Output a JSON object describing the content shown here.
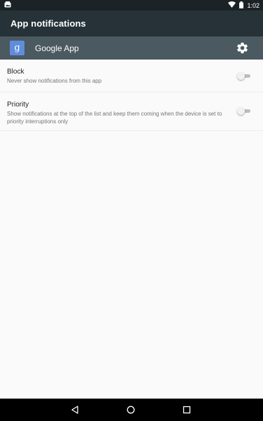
{
  "status_bar": {
    "time": "1:02",
    "icons": [
      "photo-notification-icon",
      "wifi-icon",
      "battery-icon"
    ]
  },
  "app_bar": {
    "title": "App notifications"
  },
  "app_header": {
    "icon_glyph": "g",
    "app_name": "Google App",
    "icon_color": "#5f8ddc"
  },
  "settings": [
    {
      "title": "Block",
      "summary": "Never show notifications from this app",
      "enabled": false
    },
    {
      "title": "Priority",
      "summary": "Show notifications at the top of the list and keep them coming when the device is set to priority interruptions only",
      "enabled": false
    }
  ],
  "nav_bar": {
    "buttons": [
      "back-icon",
      "home-icon",
      "recents-icon"
    ]
  },
  "colors": {
    "status_bar": "#1c2327",
    "app_bar": "#263238",
    "app_header": "#4b5960",
    "background": "#fafafa"
  }
}
